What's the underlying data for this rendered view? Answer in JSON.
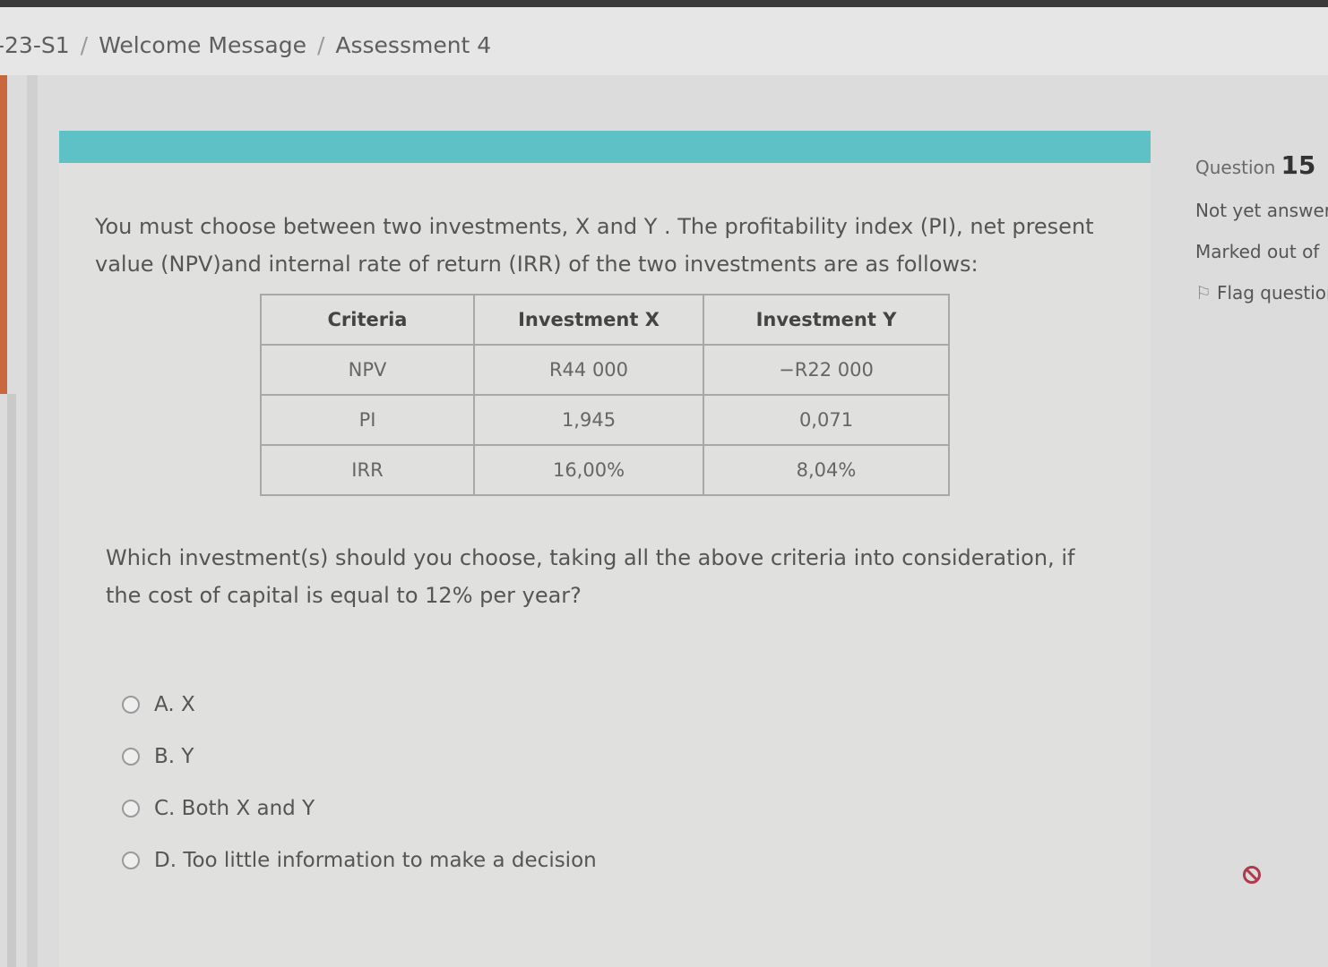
{
  "breadcrumb": {
    "items": [
      "-23-S1",
      "Welcome Message",
      "Assessment 4"
    ],
    "separator": "/"
  },
  "question_info": {
    "label": "Question",
    "number": "15",
    "status": "Not yet answered",
    "marked": "Marked out of",
    "flag_label": "Flag question",
    "flag_icon": "flag-icon"
  },
  "question": {
    "intro": "You must choose between two investments, X and Y . The profitability index (PI), net present value (NPV)and internal rate of return (IRR) of the two investments are as follows:",
    "table": {
      "headers": [
        "Criteria",
        "Investment X",
        "Investment Y"
      ],
      "rows": [
        [
          "NPV",
          "R44 000",
          "−R22 000"
        ],
        [
          "PI",
          "1,945",
          "0,071"
        ],
        [
          "IRR",
          "16,00%",
          "8,04%"
        ]
      ]
    },
    "prompt": "Which investment(s) should you choose, taking all the above criteria into consideration, if the cost of capital is equal to 12% per year?",
    "options": [
      {
        "label": "A. X"
      },
      {
        "label": "B. Y"
      },
      {
        "label": "C. Both X and Y"
      },
      {
        "label": "D. Too little information to make a decision"
      }
    ]
  },
  "colors": {
    "accent_teal": "#5ec1c6",
    "accent_orange": "#c9673f",
    "block_icon": "#b03a4a"
  }
}
